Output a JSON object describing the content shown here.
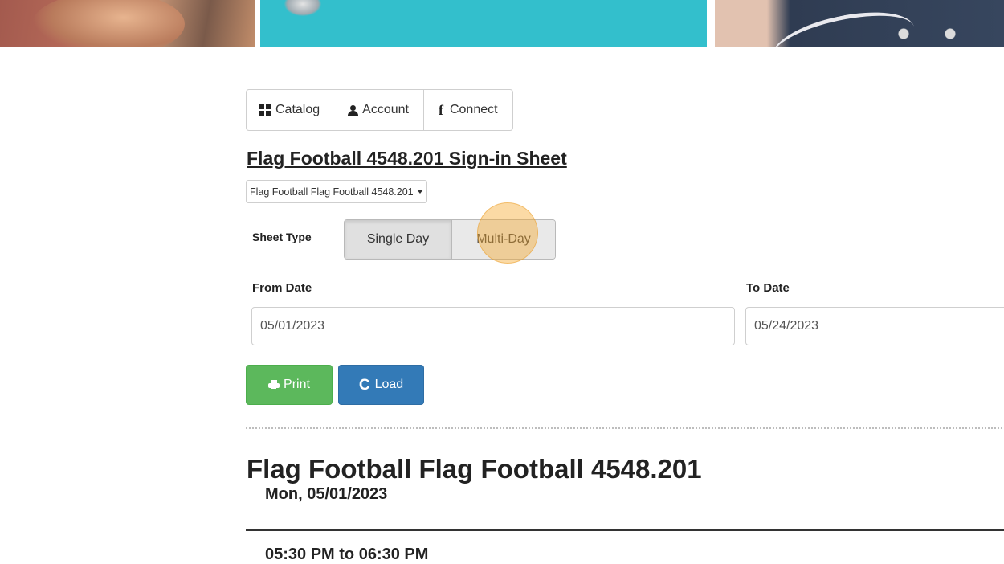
{
  "nav": {
    "catalog_label": "Catalog",
    "account_label": "Account",
    "connect_label": "Connect"
  },
  "sheet": {
    "title": "Flag Football 4548.201 Sign-in Sheet",
    "selected_program": "Flag Football Flag Football 4548.201"
  },
  "sheet_type": {
    "label": "Sheet Type",
    "options": [
      "Single Day",
      "Multi-Day"
    ],
    "selected": "Single Day"
  },
  "dates": {
    "from_label": "From Date",
    "from_value": "05/01/2023",
    "to_label": "To Date",
    "to_value": "05/24/2023"
  },
  "actions": {
    "print_label": "Print",
    "load_label": "Load"
  },
  "output": {
    "title": "Flag Football Flag Football 4548.201",
    "date": "Mon, 05/01/2023",
    "time": "05:30 PM to 06:30 PM"
  },
  "colors": {
    "print_button": "#5cb85c",
    "load_button": "#337ab7",
    "click_highlight": "#f5a828"
  },
  "icons": {
    "catalog": "grid-icon",
    "account": "user-icon",
    "connect": "facebook-icon",
    "print": "printer-icon",
    "load": "reload-icon"
  }
}
